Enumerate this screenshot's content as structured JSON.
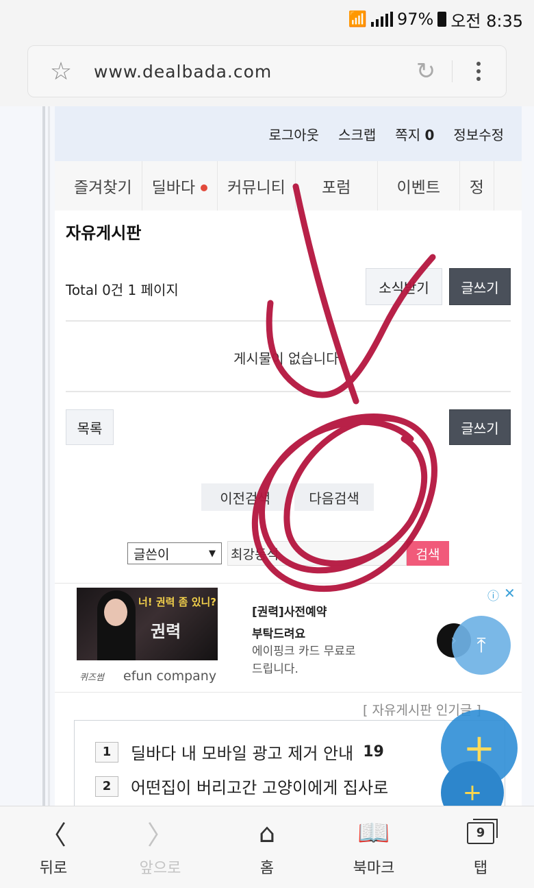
{
  "status": {
    "battery": "97%",
    "time": "오전 8:35"
  },
  "browser": {
    "url": "www.dealbada.com"
  },
  "topbar": {
    "logout": "로그아웃",
    "scrap": "스크랩",
    "memo_label": "쪽지",
    "memo_count": "0",
    "edit_info": "정보수정"
  },
  "menu": {
    "items": [
      "즐겨찾기",
      "딜바다",
      "커뮤니티",
      "포럼",
      "이벤트",
      "정"
    ]
  },
  "board": {
    "title": "자유게시판",
    "total": "Total 0건 1 페이지",
    "subscribe_btn": "소식받기",
    "write_btn": "글쓰기",
    "empty_msg": "게시물이 없습니다.",
    "list_btn": "목록",
    "write_btn2": "글쓰기",
    "prev_search": "이전검색",
    "next_search": "다음검색",
    "search_field": "글쓴이",
    "search_value": "최강동석",
    "search_btn": "검색"
  },
  "ad": {
    "slogan": "너! 권력 좀 있니?",
    "game_logo": "권력",
    "title_line1": "[권력]사전예약",
    "title_line2": "부탁드려요",
    "desc_line1": "에이핑크 카드 무료로",
    "desc_line2": "드립니다.",
    "company_logo": "퀴즈썸",
    "company": "efun company"
  },
  "popular": {
    "label": "[ 자유게시판 인기글 ]",
    "items": [
      {
        "num": "1",
        "title": "딜바다 내 모바일 광고 제거 안내",
        "count": "19"
      },
      {
        "num": "2",
        "title": "어떤집이 버리고간 고양이에게 집사로",
        "count": ""
      }
    ]
  },
  "bottomnav": {
    "back": "뒤로",
    "forward": "앞으로",
    "home": "홈",
    "bookmark": "북마크",
    "tabs": "탭",
    "tab_count": "9"
  },
  "colors": {
    "annotation": "#b5163f",
    "write_btn": "#4a505a",
    "search_btn": "#f15a7a",
    "fab": "#2f8fd6"
  }
}
